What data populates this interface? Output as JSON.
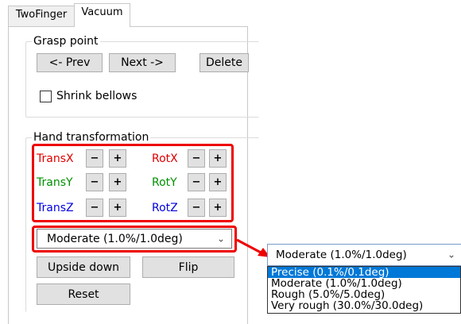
{
  "tabs": [
    {
      "label": "TwoFinger",
      "active": false
    },
    {
      "label": "Vacuum",
      "active": true
    }
  ],
  "grasp_point": {
    "title": "Grasp point",
    "prev_label": "<- Prev",
    "next_label": "Next ->",
    "delete_label": "Delete",
    "shrink_label": "Shrink bellows",
    "shrink_checked": false
  },
  "hand_transformation": {
    "title": "Hand transformation",
    "minus": "−",
    "plus": "+",
    "trans_x": "TransX",
    "trans_y": "TransY",
    "trans_z": "TransZ",
    "rot_x": "RotX",
    "rot_y": "RotY",
    "rot_z": "RotZ"
  },
  "colors": {
    "x_axis": "#e00000",
    "y_axis": "#009000",
    "z_axis": "#0000e0",
    "highlight_box": "#ee0000",
    "dropdown_highlight": "#0078d7"
  },
  "precision": {
    "selected": "Moderate (1.0%/1.0deg)",
    "options": [
      "Precise (0.1%/0.1deg)",
      "Moderate (1.0%/1.0deg)",
      "Rough (5.0%/5.0deg)",
      "Very rough (30.0%/30.0deg)"
    ],
    "highlighted_index": 0
  },
  "buttons": {
    "upside_down": "Upside down",
    "flip": "Flip",
    "reset": "Reset"
  }
}
